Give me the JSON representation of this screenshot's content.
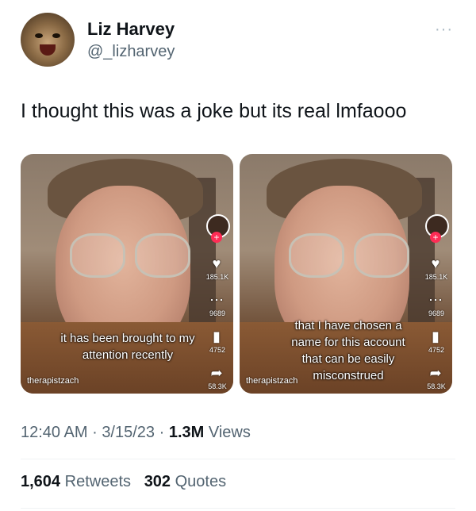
{
  "author": {
    "name": "Liz Harvey",
    "handle": "@_lizharvey",
    "avatar_icon": "cat-avatar-icon",
    "more_icon": "more-dots-icon",
    "more_glyph": "···"
  },
  "tweet": {
    "text": "I thought this was a joke but its real lmfaooo"
  },
  "media": [
    {
      "caption_lines": [
        "it has been brought to my",
        "attention recently"
      ],
      "creator": "therapistzach",
      "like_count": "185.1K",
      "comment_count": "9689",
      "save_count": "4752",
      "share_count": "58.3K"
    },
    {
      "caption_lines": [
        "that I have chosen a",
        "name for this account",
        "that can be easily",
        "misconstrued"
      ],
      "creator": "therapistzach",
      "like_count": "185.1K",
      "comment_count": "9689",
      "save_count": "4752",
      "share_count": "58.3K"
    }
  ],
  "meta": {
    "time": "12:40 AM",
    "sep1": "·",
    "date": "3/15/23",
    "sep2": "·",
    "views_count": "1.3M",
    "views_label": "Views"
  },
  "stats": {
    "retweets_count": "1,604",
    "retweets_label": "Retweets",
    "quotes_count": "302",
    "quotes_label": "Quotes"
  },
  "icons": {
    "heart": "heart-icon",
    "comment": "comment-icon",
    "bookmark": "bookmark-icon",
    "share": "share-icon"
  },
  "colors": {
    "text": "#0f1419",
    "secondary": "#536471",
    "tiktok_plus": "#fe2c55"
  }
}
